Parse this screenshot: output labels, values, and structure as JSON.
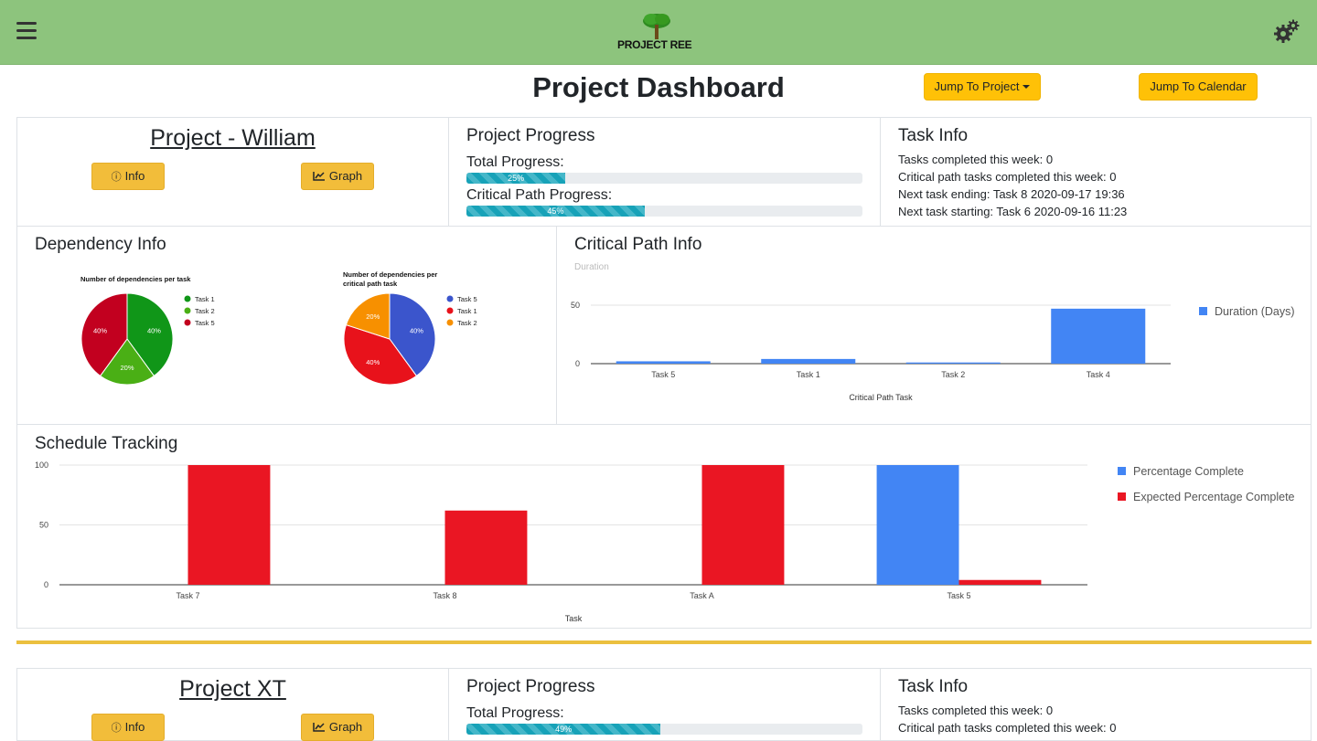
{
  "navbar": {
    "logo_text": "PROJECT  REE"
  },
  "page": {
    "title": "Project Dashboard",
    "jump_project": "Jump To Project",
    "jump_calendar": "Jump To Calendar"
  },
  "projects": [
    {
      "name": "Project - William",
      "info_label": "Info",
      "graph_label": "Graph",
      "progress": {
        "title": "Project Progress",
        "total_label": "Total Progress:",
        "total_value": 25,
        "total_text": "25%",
        "critical_label": "Critical Path Progress:",
        "critical_value": 45,
        "critical_text": "45%"
      },
      "task_info": {
        "title": "Task Info",
        "lines": [
          "Tasks completed this week: 0",
          "Critical path tasks completed this week: 0",
          "Next task ending: Task 8 2020-09-17 19:36",
          "Next task starting: Task 6 2020-09-16 11:23"
        ]
      },
      "dependency_title": "Dependency Info",
      "critical_title": "Critical Path Info",
      "schedule_title": "Schedule Tracking"
    },
    {
      "name": "Project XT",
      "info_label": "Info",
      "graph_label": "Graph",
      "progress": {
        "title": "Project Progress",
        "total_label": "Total Progress:",
        "total_value": 49,
        "total_text": "49%"
      },
      "task_info": {
        "title": "Task Info",
        "lines": [
          "Tasks completed this week: 0",
          "Critical path tasks completed this week: 0"
        ]
      }
    }
  ],
  "chart_data": [
    {
      "type": "pie",
      "title": "Number of dependencies per task",
      "categories": [
        "Task 1",
        "Task 2",
        "Task 5"
      ],
      "values": [
        40,
        20,
        40
      ],
      "labels": [
        "40%",
        "20%",
        "40%"
      ],
      "colors": [
        "#109618",
        "#4aaf15",
        "#c2001f"
      ],
      "legend": "right"
    },
    {
      "type": "pie",
      "title": "Number of dependencies per critical path task",
      "categories": [
        "Task 5",
        "Task 1",
        "Task 2"
      ],
      "values": [
        40,
        40,
        20
      ],
      "labels": [
        "40%",
        "40%",
        "20%"
      ],
      "colors": [
        "#3b55cc",
        "#e8121b",
        "#f79000"
      ],
      "legend": "right"
    },
    {
      "type": "bar",
      "subtitle": "Duration",
      "categories": [
        "Task 5",
        "Task 1",
        "Task 2",
        "Task 4"
      ],
      "series": [
        {
          "name": "Duration (Days)",
          "values": [
            2,
            4,
            1,
            47
          ],
          "color": "#4285f4"
        }
      ],
      "xlabel": "Critical Path Task",
      "ylim": [
        0,
        50
      ],
      "yticks": [
        "0",
        "50"
      ],
      "legend": "right"
    },
    {
      "type": "bar",
      "categories": [
        "Task 7",
        "Task 8",
        "Task A",
        "Task 5"
      ],
      "series": [
        {
          "name": "Percentage Complete",
          "values": [
            0,
            0,
            0,
            100
          ],
          "color": "#4285f4"
        },
        {
          "name": "Expected Percentage Complete",
          "values": [
            100,
            62,
            100,
            4
          ],
          "color": "#ea1623"
        }
      ],
      "xlabel": "Task",
      "ylim": [
        0,
        100
      ],
      "yticks": [
        "0",
        "50",
        "100"
      ],
      "legend": "right"
    }
  ]
}
